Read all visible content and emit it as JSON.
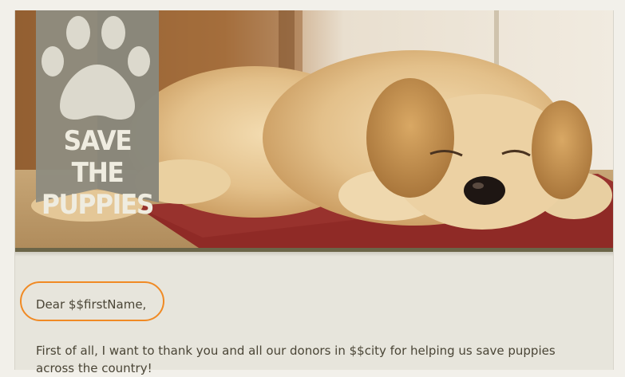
{
  "hero": {
    "logo_line1": "SAVE THE",
    "logo_line2": "PUPPIES",
    "paw_icon": "paw-print-icon"
  },
  "letter": {
    "greeting": "Dear $$firstName,",
    "paragraph1": "First of all, I want to thank you and all our donors in $$city for helping us save puppies across the country!"
  },
  "colors": {
    "highlight_outline": "#f08a24",
    "ribbon": "#8e8c80",
    "text": "#4a4536"
  }
}
